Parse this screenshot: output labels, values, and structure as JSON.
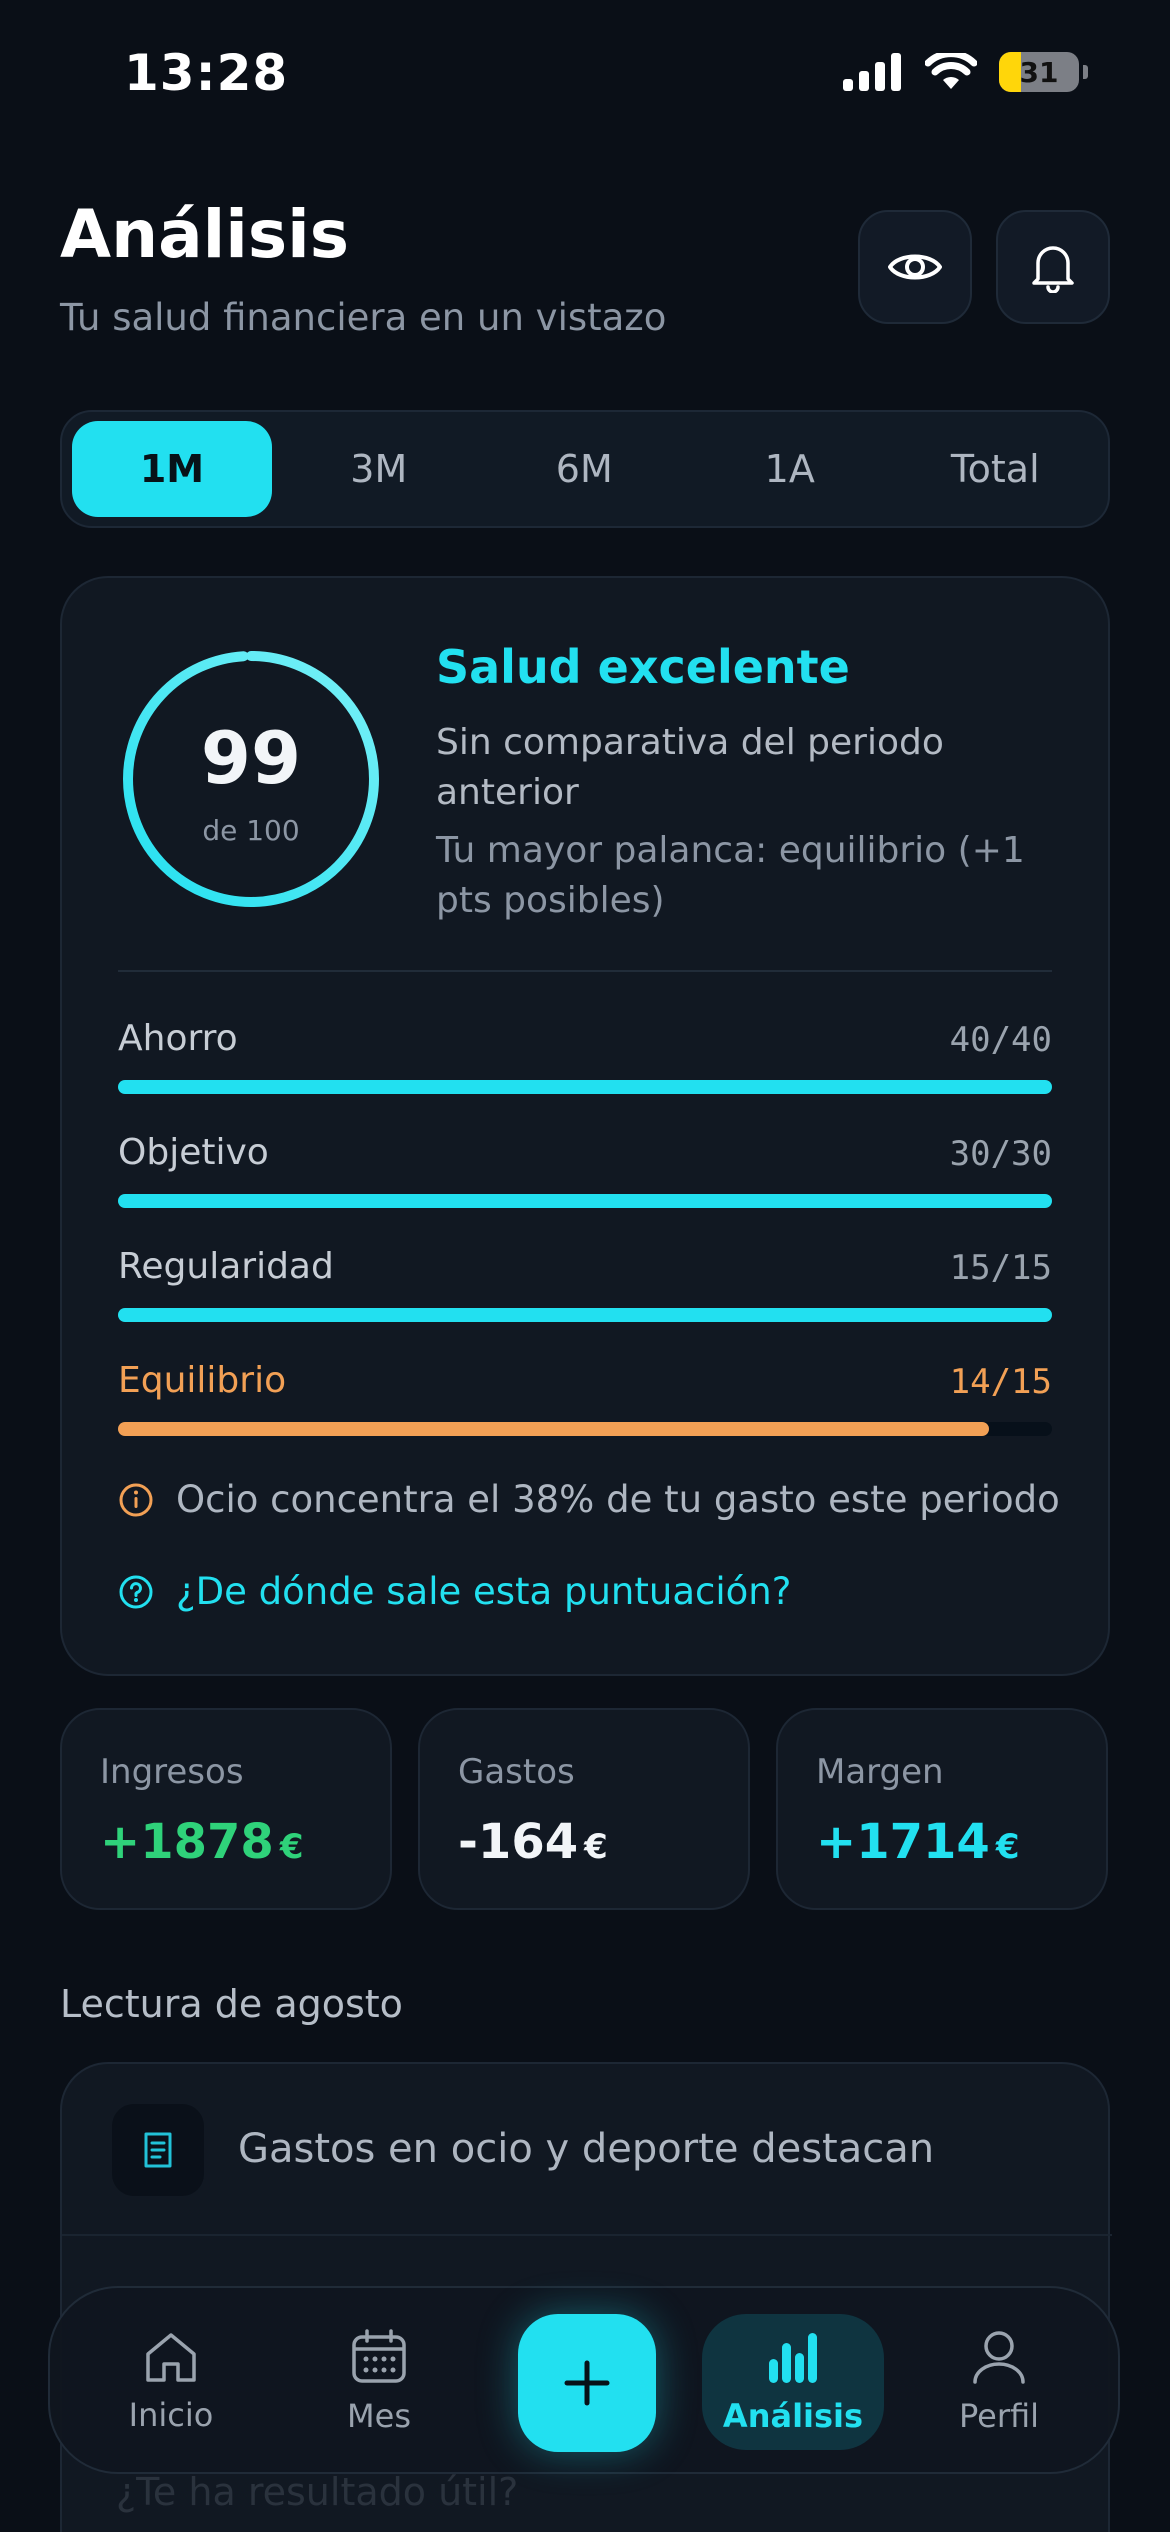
{
  "status_bar": {
    "time": "13:28",
    "battery": "31"
  },
  "header": {
    "title": "Análisis",
    "subtitle": "Tu salud financiera en un vistazo"
  },
  "period_tabs": {
    "selected": "1M",
    "items": [
      "1M",
      "3M",
      "6M",
      "1A",
      "Total"
    ]
  },
  "health": {
    "score": "99",
    "score_of": "de 100",
    "score_value": 99,
    "status": "Salud excelente",
    "comparison": "Sin comparativa del periodo anterior",
    "lever": "Tu mayor palanca: equilibrio (+1 pts posibles)",
    "metrics": [
      {
        "label": "Ahorro",
        "value": "40/40",
        "fraction": 1.0
      },
      {
        "label": "Objetivo",
        "value": "30/30",
        "fraction": 1.0
      },
      {
        "label": "Regularidad",
        "value": "15/15",
        "fraction": 1.0
      },
      {
        "label": "Equilibrio",
        "value": "14/15",
        "fraction": 0.933
      }
    ],
    "warning": "Ocio concentra el 38% de tu gasto este periodo",
    "help_link": "¿De dónde sale esta puntuación?"
  },
  "summary": {
    "ingresos": {
      "label": "Ingresos",
      "value": "+1878",
      "currency": "€"
    },
    "gastos": {
      "label": "Gastos",
      "value": "-164",
      "currency": "€"
    },
    "margen": {
      "label": "Margen",
      "value": "+1714",
      "currency": "€"
    }
  },
  "reading": {
    "title": "Lectura de agosto",
    "items": [
      {
        "text": "Gastos en ocio y deporte destacan",
        "icon": "receipt-icon"
      }
    ],
    "footer_hint": "¿Te ha resultado útil?"
  },
  "nav": {
    "items": [
      {
        "label": "Inicio",
        "icon": "home-icon"
      },
      {
        "label": "Mes",
        "icon": "calendar-icon"
      },
      {
        "label": "Análisis",
        "icon": "bar-chart-icon"
      },
      {
        "label": "Perfil",
        "icon": "user-icon"
      }
    ],
    "active": "Análisis"
  },
  "colors": {
    "accent": "#22e0f0",
    "warning": "#f2a055",
    "positive": "#2fd27a",
    "background": "#0a0f17"
  }
}
